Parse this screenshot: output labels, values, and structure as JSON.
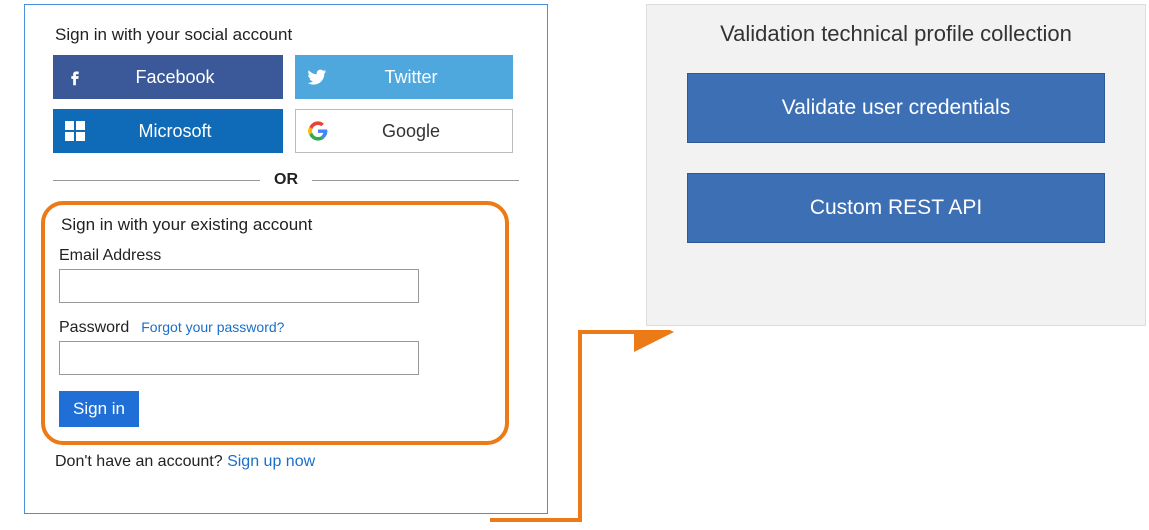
{
  "signin": {
    "social_heading": "Sign in with your social account",
    "providers": {
      "facebook": "Facebook",
      "twitter": "Twitter",
      "microsoft": "Microsoft",
      "google": "Google"
    },
    "or_label": "OR",
    "local_heading": "Sign in with your existing account",
    "email_label": "Email Address",
    "email_value": "",
    "password_label": "Password",
    "password_value": "",
    "forgot_link": "Forgot your password?",
    "signin_button": "Sign in",
    "signup_prompt": "Don't have an account?",
    "signup_link": "Sign up now"
  },
  "validation": {
    "title": "Validation technical profile collection",
    "blocks": [
      "Validate user credentials",
      "Custom REST API"
    ]
  },
  "colors": {
    "highlight_border": "#ec7a16",
    "arrow": "#ec7a16",
    "panel_border": "#4a90d9",
    "validation_block": "#3d6fb5"
  }
}
